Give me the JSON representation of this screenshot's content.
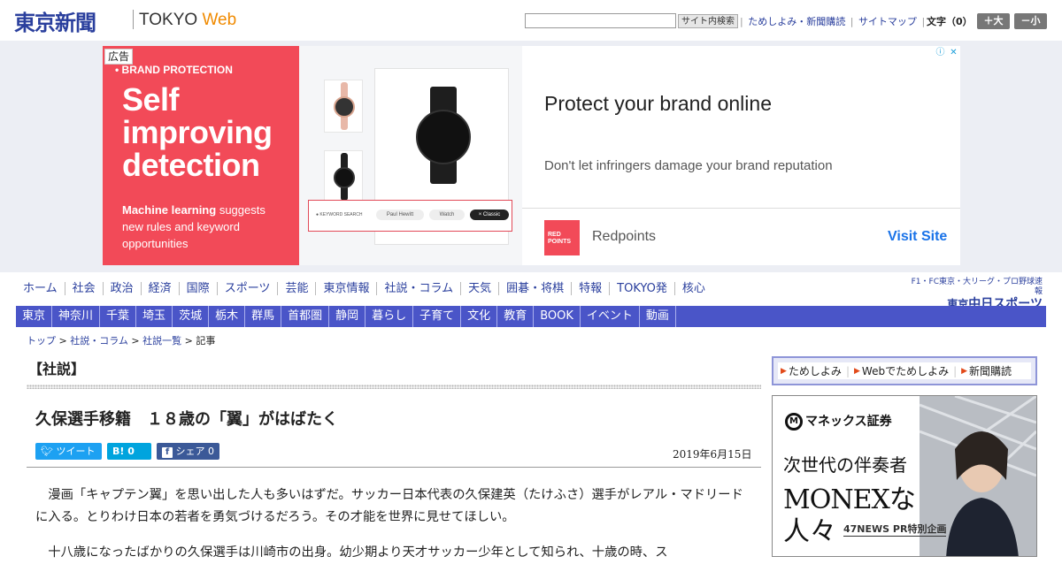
{
  "header": {
    "logo_jp": "東京新聞",
    "logo_en_a": "TOKYO",
    "logo_en_b": "Web",
    "search_placeholder": "",
    "search_button": "サイト内検索",
    "links": [
      "ためしよみ・新聞購読",
      "サイトマップ"
    ],
    "moji_label": "文字（0）",
    "size_up": "＋大",
    "size_down": "－小"
  },
  "ad": {
    "label": "広告",
    "brand_protection": "• BRAND PROTECTION",
    "headline": "Self improving detection",
    "sub_bold": "Machine learning",
    "sub_rest": " suggests new rules and keyword opportunities",
    "mock_keyword": "● KEYWORD SEARCH",
    "mock_pills": [
      "Paul Hewitt",
      "Watch",
      "× Classic"
    ],
    "title": "Protect your brand online",
    "description": "Don't let infringers damage your brand reputation",
    "brand_logo": "RED POINTS",
    "brand_name": "Redpoints",
    "cta": "Visit Site",
    "choices_info": "ⓘ",
    "choices_close": "✕"
  },
  "nav": {
    "primary": [
      "ホーム",
      "社会",
      "政治",
      "経済",
      "国際",
      "スポーツ",
      "芸能",
      "東京情報",
      "社説・コラム",
      "天気",
      "囲碁・将棋",
      "特報",
      "TOKYO発",
      "核心"
    ],
    "secondary": [
      "東京",
      "神奈川",
      "千葉",
      "埼玉",
      "茨城",
      "栃木",
      "群馬",
      "首都圏",
      "静岡",
      "暮らし",
      "子育て",
      "文化",
      "教育",
      "BOOK",
      "イベント",
      "動画"
    ],
    "chunichi_top": "F1・FC東京・大リーグ・プロ野球速報",
    "chunichi_logo_a": "東京",
    "chunichi_logo_b": "中日スポーツ"
  },
  "breadcrumb": {
    "items": [
      "トップ",
      "社説・コラム",
      "社説一覧"
    ],
    "current": "記事",
    "sep": " > "
  },
  "article": {
    "section": "【社説】",
    "headline": "久保選手移籍　１８歳の「翼」がはばたく",
    "tweet": "ツイート",
    "hatena": "B! 0",
    "facebook": "シェア 0",
    "date": "2019年6月15日",
    "para1": "　漫画「キャプテン翼」を思い出した人も多いはずだ。サッカー日本代表の久保建英（たけふさ）選手がレアル・マドリードに入る。とりわけ日本の若者を勇気づけるだろう。その才能を世界に見せてほしい。",
    "para2": "　十八歳になったばかりの久保選手は川崎市の出身。幼少期より天才サッカー少年として知られ、十歳の時、ス"
  },
  "sidebar": {
    "links": [
      "ためしよみ",
      "Webでためしよみ",
      "新聞購読"
    ],
    "monex_logo_m": "M",
    "monex_logo": "マネックス証券",
    "monex_line1": "次世代の伴奏者",
    "monex_line2": "MONEXな",
    "monex_line3": "人々",
    "monex_pr": "47NEWS PR特別企画"
  }
}
